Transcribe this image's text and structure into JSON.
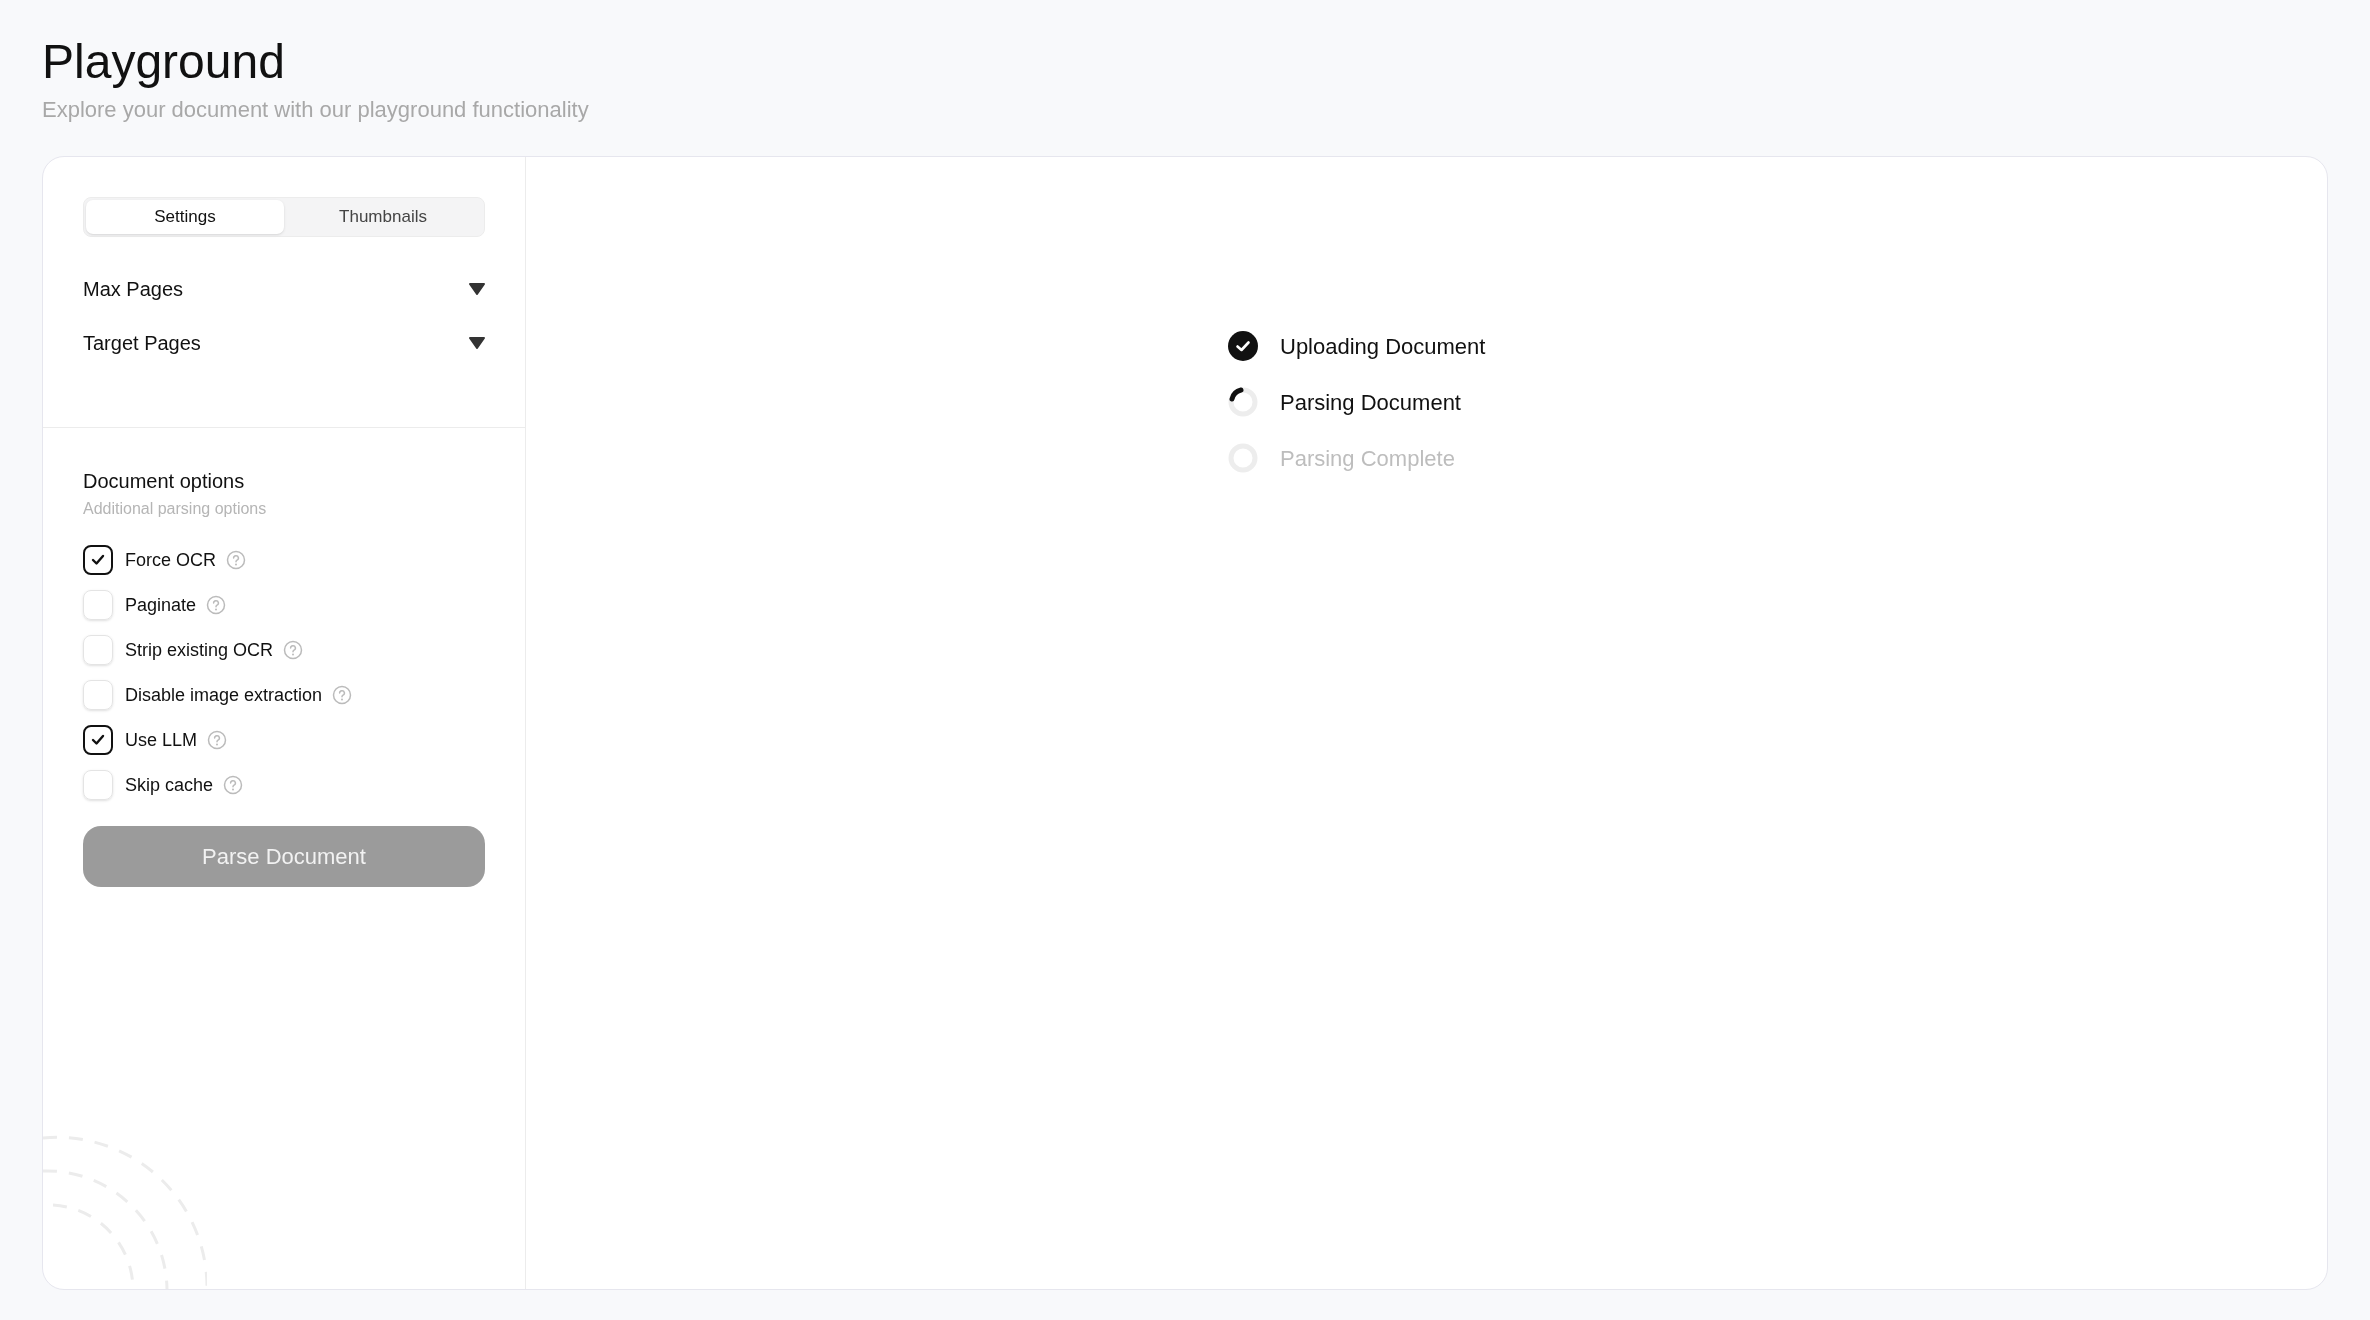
{
  "header": {
    "title": "Playground",
    "subtitle": "Explore your document with our playground functionality"
  },
  "tabs": [
    {
      "label": "Settings",
      "selected": true
    },
    {
      "label": "Thumbnails",
      "selected": false
    }
  ],
  "dropdowns": [
    {
      "label": "Max Pages"
    },
    {
      "label": "Target Pages"
    }
  ],
  "document_options": {
    "title": "Document options",
    "subtitle": "Additional parsing options",
    "options": [
      {
        "label": "Force OCR",
        "checked": true
      },
      {
        "label": "Paginate",
        "checked": false
      },
      {
        "label": "Strip existing OCR",
        "checked": false
      },
      {
        "label": "Disable image extraction",
        "checked": false
      },
      {
        "label": "Use LLM",
        "checked": true
      },
      {
        "label": "Skip cache",
        "checked": false
      }
    ]
  },
  "parse_button": {
    "label": "Parse Document",
    "disabled": true
  },
  "steps": [
    {
      "label": "Uploading Document",
      "done": true,
      "active": false
    },
    {
      "label": "Parsing Document",
      "done": false,
      "active": true
    },
    {
      "label": "Parsing Complete",
      "done": false,
      "active": false
    }
  ]
}
